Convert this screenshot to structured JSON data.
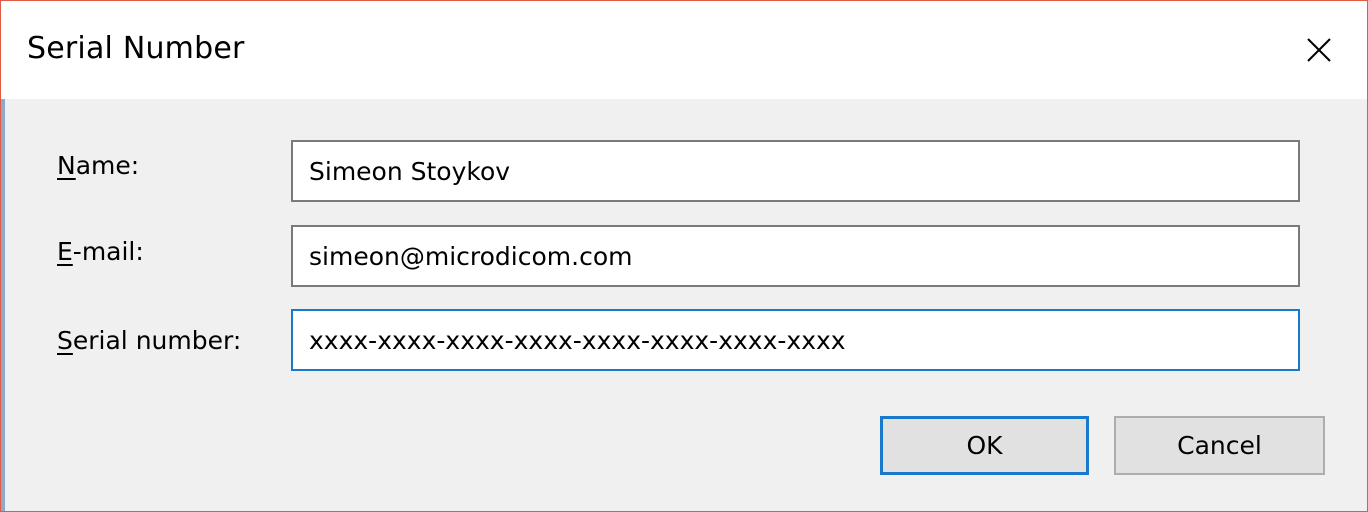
{
  "window": {
    "title": "Serial Number"
  },
  "form": {
    "name_label_mnemonic": "N",
    "name_label_rest": "ame:",
    "name_value": "Simeon Stoykov",
    "email_label_mnemonic": "E",
    "email_label_rest": "-mail:",
    "email_value": "simeon@microdicom.com",
    "serial_label_mnemonic": "S",
    "serial_label_rest": "erial number:",
    "serial_value": "xxxx-xxxx-xxxx-xxxx-xxxx-xxxx-xxxx-xxxx"
  },
  "buttons": {
    "ok_label": "OK",
    "cancel_label": "Cancel"
  },
  "colors": {
    "accent": "#1979ca",
    "window_border": "#e15a45"
  },
  "icons": {
    "close": "close-icon"
  }
}
